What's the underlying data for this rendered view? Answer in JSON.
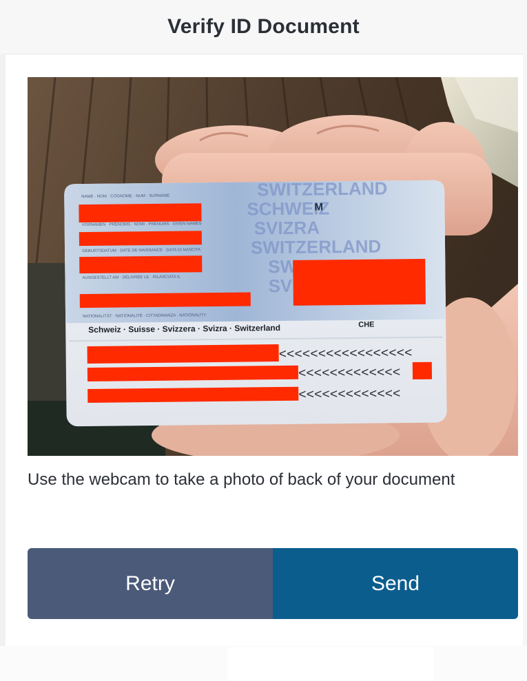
{
  "header": {
    "title": "Verify ID Document"
  },
  "photo": {
    "card": {
      "title_watermark": "SWITZERLAND",
      "watermark_words": [
        "SWITZERLAND",
        "SCHWEIZ",
        "SVIZRA",
        "SWISSE",
        "SVIZZERA"
      ],
      "sex_value": "M",
      "nationality_line": "Schweiz · Suisse · Svizzera · Svizra · Switzerland",
      "country_code": "CHE",
      "mrz_line_1": "<<<<<<<<<<<<<<<<<",
      "mrz_line_2": "<<<<<<<<<<<<<",
      "mrz_line_3": "<<<<<<<<<<<<<",
      "label_row_1": "NAME · NOM · COGNOME · NUM · SURNAME",
      "label_row_2": "VORNAMEN · PRÉNOMS · NOMI · PRENUMS · GIVEN NAMES",
      "label_row_3": "GEBURTSDATUM · DATE DE NAISSANCE · DATA DI NASCITA",
      "label_row_4": "AUSGESTELLT AM · DÉLIVRÉE LE · RILASCIATA IL",
      "label_row_5": "NATIONALITÄT · NATIONALITÉ · CITTADINANZA · NATIONALITY"
    },
    "redaction_color": "#ff2a00"
  },
  "instruction": "Use the webcam to take a photo of back of your document",
  "actions": {
    "retry_label": "Retry",
    "send_label": "Send",
    "retry_color": "#4b5a78",
    "send_color": "#0b5d8e"
  }
}
